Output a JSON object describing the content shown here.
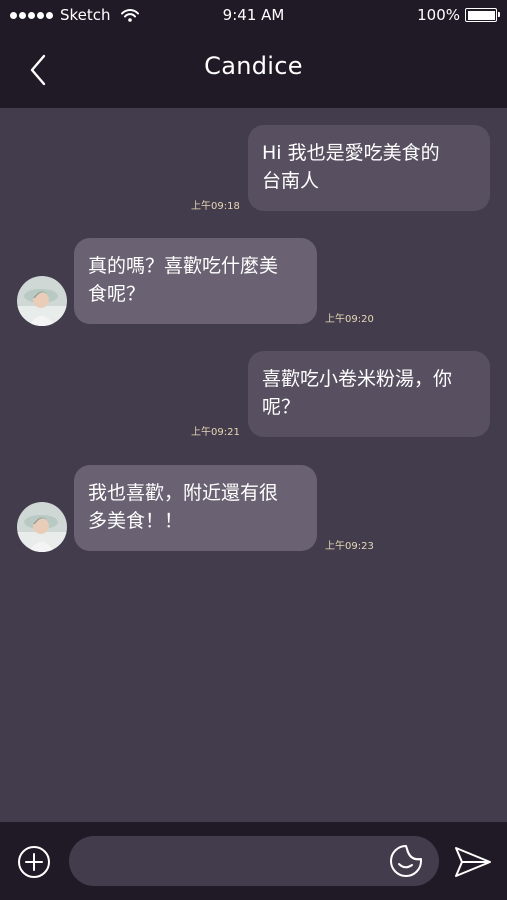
{
  "status_bar": {
    "carrier": "Sketch",
    "time": "9:41 AM",
    "battery": "100%",
    "battery_level": 1.0
  },
  "header": {
    "title": "Candice",
    "back_icon": "chevron-left-icon"
  },
  "messages": [
    {
      "direction": "out",
      "line1": "Hi 我也是愛吃美食的",
      "line2": "台南人",
      "time": "上午09:18"
    },
    {
      "direction": "in",
      "line1": "真的嗎？喜歡吃什麼美",
      "line2": "食呢？",
      "time": "上午09:20"
    },
    {
      "direction": "out",
      "line1": "喜歡吃小卷米粉湯，你",
      "line2": "呢？",
      "time": "上午09:21"
    },
    {
      "direction": "in",
      "line1": "我也喜歡，附近還有很",
      "line2": "多美食！！",
      "time": "上午09:23"
    }
  ],
  "input_bar": {
    "placeholder": "",
    "value": "",
    "plus_icon": "plus-circle-icon",
    "sticker_icon": "sticker-icon",
    "send_icon": "send-icon"
  },
  "colors": {
    "bar_background": "#1f1a26",
    "chat_background": "#433c4d",
    "outgoing_bubble": "#585061",
    "incoming_bubble": "#6a6272",
    "timestamp": "#e6d7b4"
  }
}
